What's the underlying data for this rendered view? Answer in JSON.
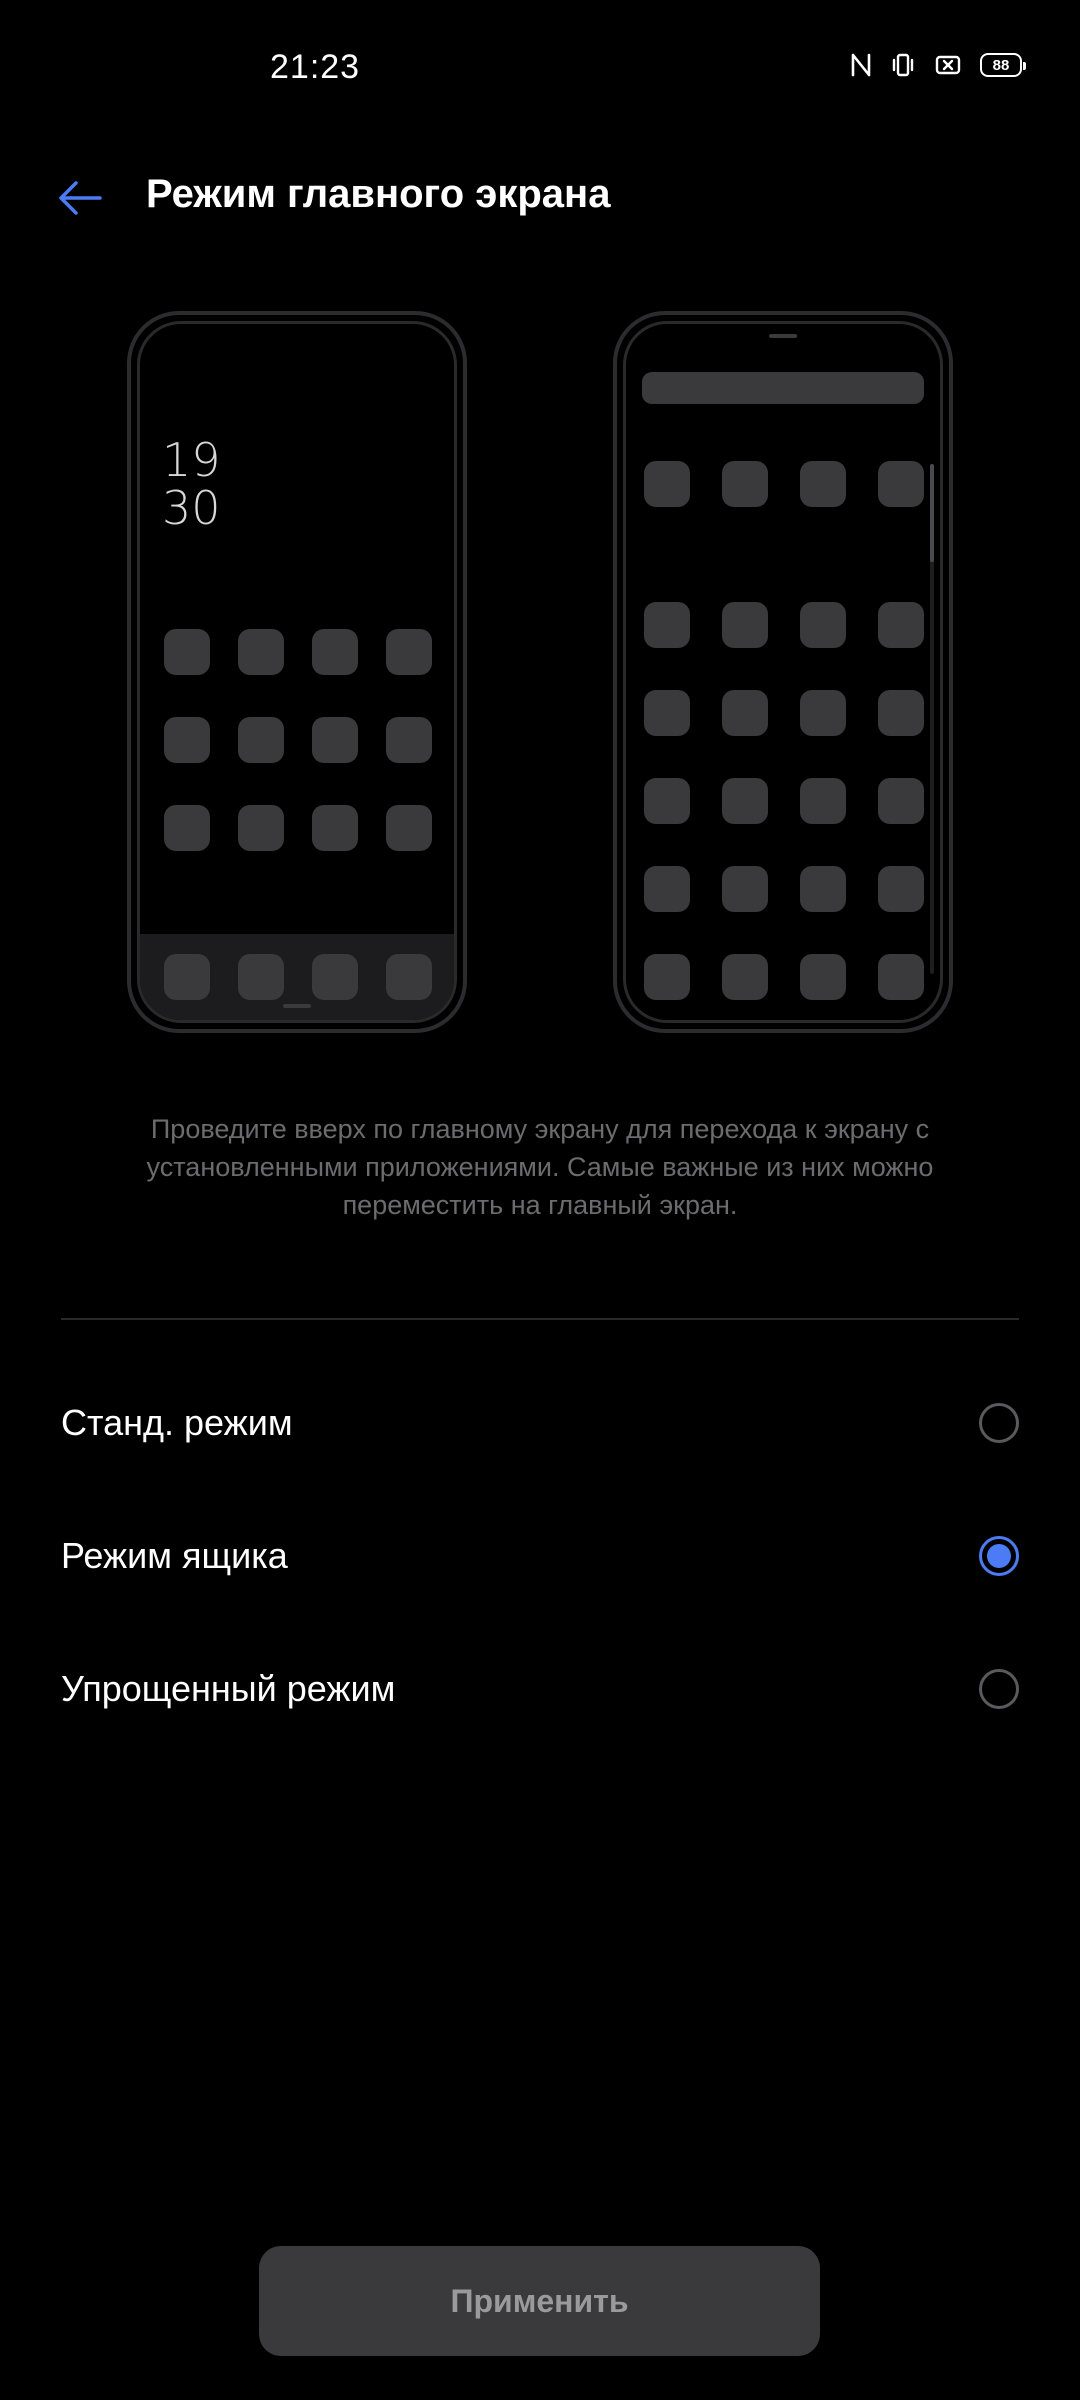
{
  "status_bar": {
    "time": "21:23",
    "icons": [
      "nfc-icon",
      "vibrate-icon",
      "no-sim-icon",
      "battery-icon"
    ],
    "battery_level": "88"
  },
  "header": {
    "back_icon": "arrow-left-icon",
    "title": "Режим главного экрана"
  },
  "preview": {
    "standard_clock_hour": "19",
    "standard_clock_minute": "30"
  },
  "description": "Проведите вверх по главному экрану для перехода к экрану с установленными приложениями. Самые важные из них можно переместить на главный экран.",
  "options": [
    {
      "label": "Станд. режим",
      "selected": false
    },
    {
      "label": "Режим ящика",
      "selected": true
    },
    {
      "label": "Упрощенный режим",
      "selected": false
    }
  ],
  "apply_label": "Применить",
  "colors": {
    "accent": "#4b7bf5",
    "background": "#000000",
    "button_bg": "#3a3a3c"
  }
}
